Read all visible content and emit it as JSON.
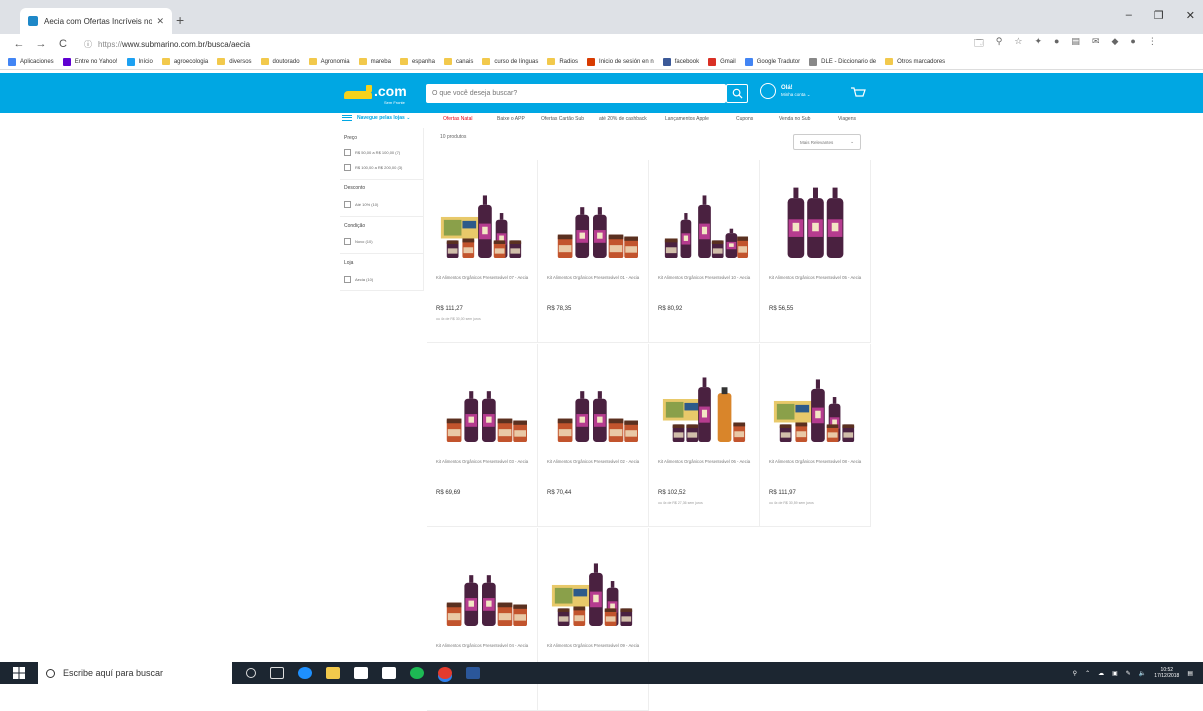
{
  "browser": {
    "tab_title": "Aecia com Ofertas Incríveis no S",
    "url_prefix": "https://",
    "url_main": "www.submarino.com.br/busca/aecia",
    "bookmarks": [
      {
        "label": "Aplicaciones",
        "type": "apps"
      },
      {
        "label": "Entre no Yahoo!",
        "type": "yahoo"
      },
      {
        "label": "Início",
        "type": "twitter"
      },
      {
        "label": "agroecologia",
        "type": "folder"
      },
      {
        "label": "diversos",
        "type": "folder"
      },
      {
        "label": "doutorado",
        "type": "folder"
      },
      {
        "label": "Agronomia",
        "type": "folder"
      },
      {
        "label": "mareba",
        "type": "folder"
      },
      {
        "label": "espanha",
        "type": "folder"
      },
      {
        "label": "canais",
        "type": "folder"
      },
      {
        "label": "curso de línguas",
        "type": "folder"
      },
      {
        "label": "Radios",
        "type": "folder"
      },
      {
        "label": "Inicio de sesión en n",
        "type": "office"
      },
      {
        "label": "facebook",
        "type": "facebook"
      },
      {
        "label": "Gmail",
        "type": "gmail"
      },
      {
        "label": "Google Tradutor",
        "type": "translate"
      },
      {
        "label": "DLE - Diccionario de",
        "type": "dle"
      },
      {
        "label": "Otros marcadores",
        "type": "folder"
      }
    ]
  },
  "header": {
    "logo_text": ".com",
    "logo_tagline": "Sem Fronte",
    "search_placeholder": "O que você deseja buscar?",
    "greeting": "Olá!",
    "account_link": "Minha conta ⌄"
  },
  "catnav": {
    "menu_label": "Navegue pelas lojas ⌄",
    "links": [
      "Ofertas Natal",
      "Baixe o APP",
      "Ofertas Cartão Sub",
      "até 20% de cashback",
      "Lançamentos Apple",
      "Cupons",
      "Venda no Sub",
      "Viagens"
    ]
  },
  "filters": {
    "groups": [
      {
        "title": "Preço",
        "options": [
          "R$ 50,00 a R$ 100,00 (7)",
          "R$ 100,00 a R$ 200,00 (3)"
        ]
      },
      {
        "title": "Desconto",
        "options": [
          "Até 10% (10)"
        ]
      },
      {
        "title": "Condição",
        "options": [
          "Novo (10)"
        ]
      },
      {
        "title": "Loja",
        "options": [
          "Aecia (10)"
        ]
      }
    ]
  },
  "results": {
    "count": "10 produtos",
    "sort_label": "Mais Relevantes",
    "products": [
      {
        "name": "Kit Alimentos Orgânicos Presenteável 07 - Aecia",
        "price": "R$ 111,27",
        "sub": "ou 4x de R$ 30,00 sem juros",
        "variant": "box"
      },
      {
        "name": "Kit Alimentos Orgânicos Presenteável 01 - Aecia",
        "price": "R$ 78,35",
        "sub": "",
        "variant": "bottles"
      },
      {
        "name": "Kit Alimentos Orgânicos Presenteável 10 - Aecia",
        "price": "R$ 80,92",
        "sub": "",
        "variant": "mixed"
      },
      {
        "name": "Kit Alimentos Orgânicos Presenteável 05 - Aecia",
        "price": "R$ 56,55",
        "sub": "",
        "variant": "three"
      },
      {
        "name": "Kit Alimentos Orgânicos Presenteável 03 - Aecia",
        "price": "R$ 69,69",
        "sub": "",
        "variant": "bottles"
      },
      {
        "name": "Kit Alimentos Orgânicos Presenteável 02 - Aecia",
        "price": "R$ 70,44",
        "sub": "",
        "variant": "bottles"
      },
      {
        "name": "Kit Alimentos Orgânicos Presenteável 06 - Aecia",
        "price": "R$ 102,52",
        "sub": "ou 4x de R$ 27,36 sem juros",
        "variant": "boxjuice"
      },
      {
        "name": "Kit Alimentos Orgânicos Presenteável 08 - Aecia",
        "price": "R$ 111,97",
        "sub": "ou 4x de R$ 30,59 sem juros",
        "variant": "box"
      },
      {
        "name": "Kit Alimentos Orgânicos Presenteável 04 - Aecia",
        "price": "",
        "sub": "",
        "variant": "bottles"
      },
      {
        "name": "Kit Alimentos Orgânicos Presenteável 09 - Aecia",
        "price": "",
        "sub": "",
        "variant": "box"
      }
    ]
  },
  "taskbar": {
    "search_placeholder": "Escribe aquí para buscar",
    "time": "10:52",
    "date": "17/12/2018"
  },
  "colors": {
    "brand_blue": "#00a7e3",
    "brand_yellow": "#f6d21b",
    "accent_red": "#e60014",
    "bottle_purple": "#4a2140",
    "label_magenta": "#b53c8f",
    "jar_orange": "#c2542d"
  }
}
